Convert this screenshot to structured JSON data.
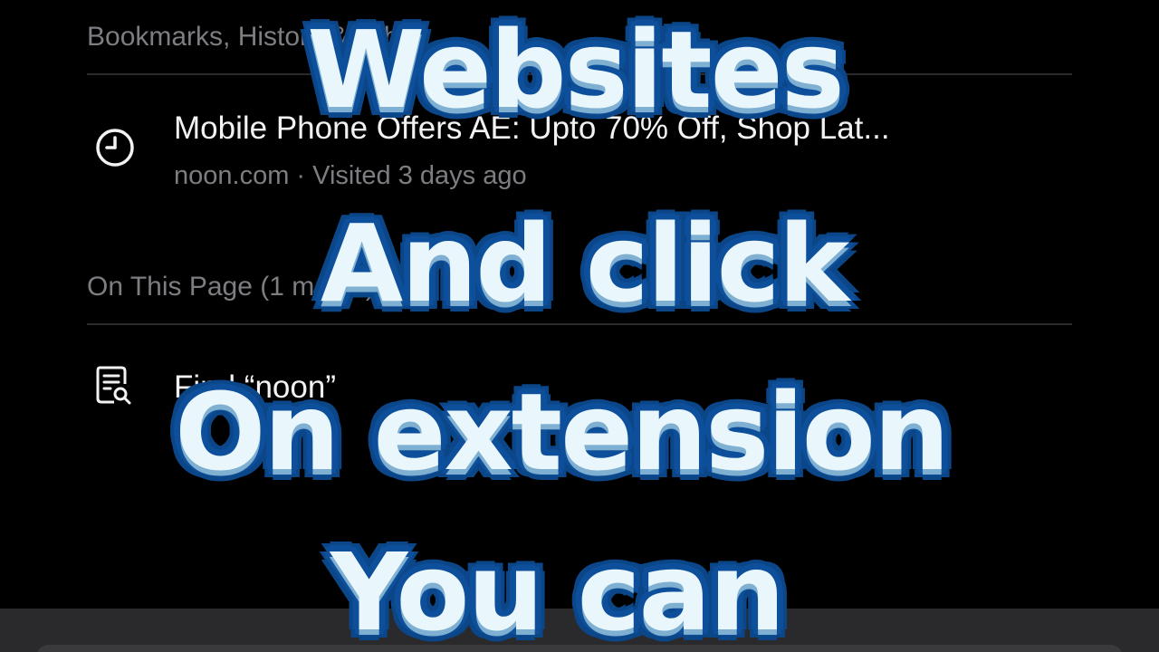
{
  "sections": {
    "bookmarks_header": "Bookmarks, History & Tabs",
    "on_page_header": "On This Page (1 match)"
  },
  "history_item": {
    "title": "Mobile Phone Offers AE: Upto 70% Off, Shop Lat...",
    "subtitle": "noon.com · Visited 3 days ago",
    "icon": "clock-icon"
  },
  "find_item": {
    "label": "Find “noon”",
    "icon": "find-in-page-icon"
  },
  "captions": {
    "line1": "Websites",
    "line2": "And click",
    "line3": "On extension",
    "line4": "You can"
  },
  "colors": {
    "background": "#000000",
    "secondary_text": "#7d7d82",
    "caption_fill": "#e9f6fb",
    "caption_outline": "#0d4f9a"
  }
}
